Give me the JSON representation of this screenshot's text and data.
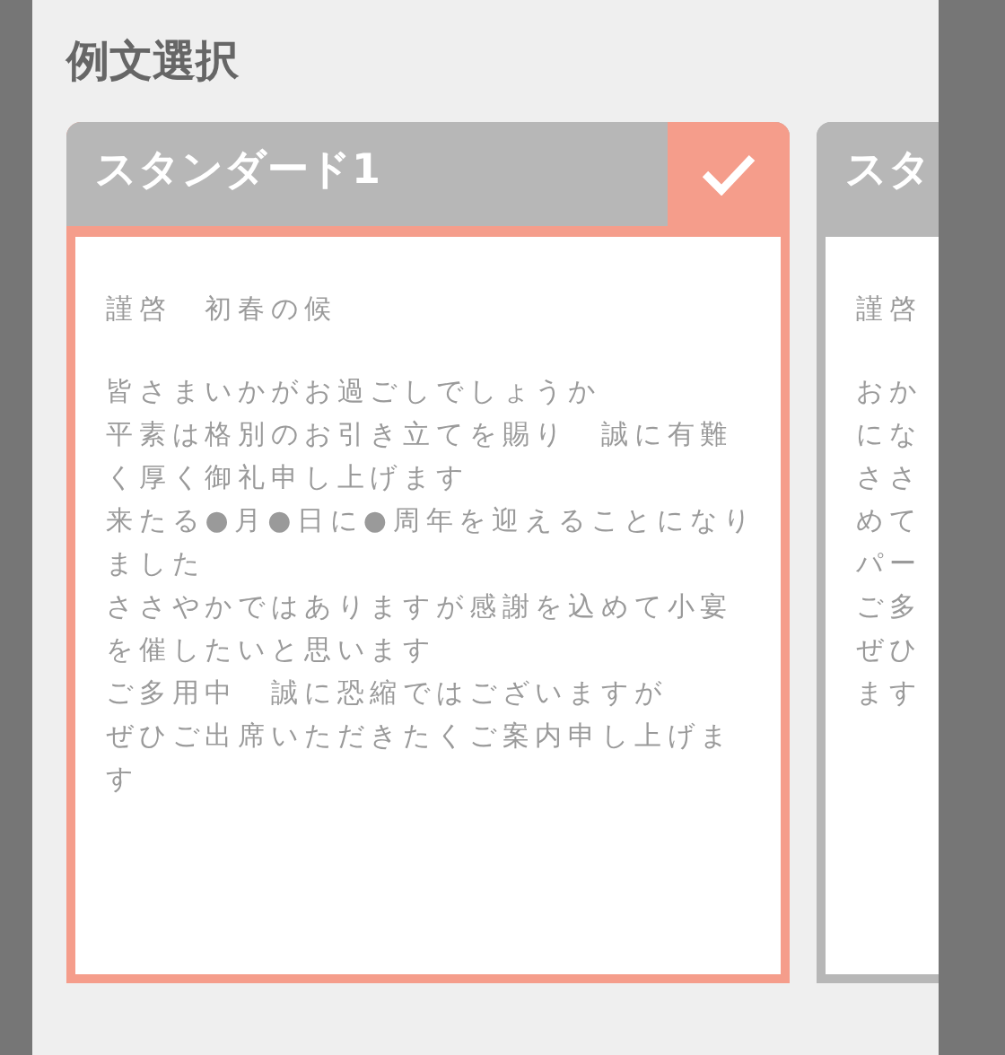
{
  "title": "例文選択",
  "cards": [
    {
      "title": "スタンダード1",
      "selected": true,
      "paragraphs": [
        [
          "謹啓　初春の候"
        ],
        [
          "皆さまいかがお過ごしでしょうか",
          "平素は格別のお引き立てを賜り　誠に有難",
          "く厚く御礼申し上げます",
          "来たる●月●日に●周年を迎えることになり",
          "ました",
          "ささやかではありますが感謝を込めて小宴",
          "を催したいと思います",
          "ご多用中　誠に恐縮ではございますが",
          "ぜひご出席いただきたくご案内申し上げま",
          "す"
        ]
      ]
    },
    {
      "title": "スタ",
      "selected": false,
      "paragraphs": [
        [
          "謹啓"
        ],
        [
          "おか",
          "にな",
          "ささ",
          "めて",
          "パー",
          "ご多",
          "ぜひ",
          "ます"
        ]
      ]
    }
  ]
}
